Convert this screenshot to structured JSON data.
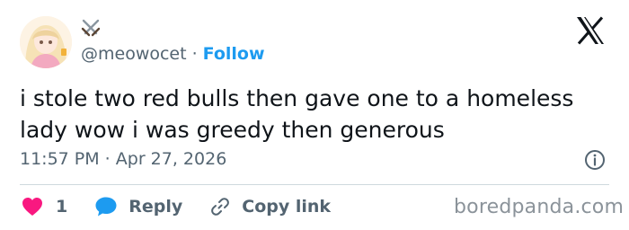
{
  "post": {
    "handle": "@meowocet",
    "separator": "·",
    "follow_label": "Follow",
    "text_lines": [
      "i stole two red bulls then gave one to a homeless",
      "lady wow i was greedy then generous"
    ],
    "timestamp": "11:57 PM · Apr 27, 2026",
    "display_name_icon": "crossed-swords-icon",
    "avatar": "anime-avatar"
  },
  "actions": {
    "like_count": "1",
    "reply_label": "Reply",
    "copy_link_label": "Copy link"
  },
  "watermark": "boredpanda.com",
  "colors": {
    "accent": "#1d9bf0",
    "text": "#0f1419",
    "muted": "#536471",
    "like": "#f91880",
    "divider": "#cfd9de"
  }
}
